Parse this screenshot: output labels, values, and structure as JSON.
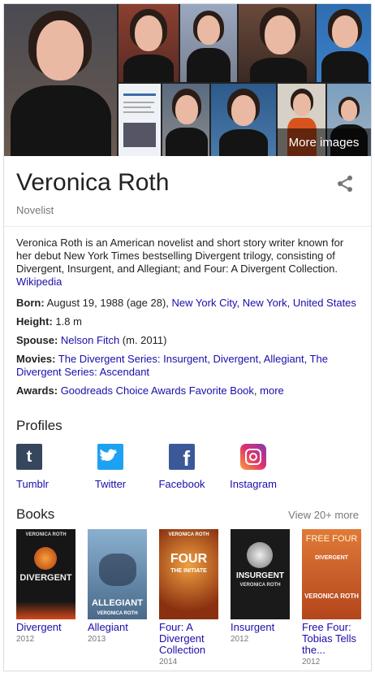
{
  "images": {
    "more_label": "More images"
  },
  "header": {
    "title": "Veronica Roth",
    "subtitle": "Novelist",
    "share_icon": "share-icon"
  },
  "description": {
    "text": "Veronica Roth is an American novelist and short story writer known for her debut New York Times bestselling Divergent trilogy, consisting of Divergent, Insurgent, and Allegiant; and Four: A Divergent Collection.",
    "source": "Wikipedia"
  },
  "facts": {
    "born": {
      "label": "Born:",
      "date": "August 19, 1988 (age 28),",
      "place": "New York City, New York, United States"
    },
    "height": {
      "label": "Height:",
      "value": "1.8 m"
    },
    "spouse": {
      "label": "Spouse:",
      "name": "Nelson Fitch",
      "detail": "(m. 2011)"
    },
    "movies": {
      "label": "Movies:",
      "value": "The Divergent Series: Insurgent, Divergent, Allegiant, The Divergent Series: Ascendant"
    },
    "awards": {
      "label": "Awards:",
      "value": "Goodreads Choice Awards Favorite Book",
      "more": "more"
    }
  },
  "profiles": {
    "heading": "Profiles",
    "items": [
      {
        "label": "Tumblr",
        "color": "#36465d",
        "glyph": "t"
      },
      {
        "label": "Twitter",
        "color": "#1da1f2",
        "glyph": ""
      },
      {
        "label": "Facebook",
        "color": "#3b5998",
        "glyph": "f"
      },
      {
        "label": "Instagram",
        "color": "#c13584",
        "glyph": ""
      }
    ]
  },
  "books": {
    "heading": "Books",
    "view_more": "View 20+ more",
    "items": [
      {
        "title": "Divergent",
        "year": "2012",
        "cover_author": "VERONICA ROTH",
        "cover_title": "DIVERGENT",
        "bg": "#1a1a1a",
        "fg": "#f0f0f0"
      },
      {
        "title": "Allegiant",
        "year": "2013",
        "cover_author": "VERONICA ROTH",
        "cover_title": "ALLEGIANT",
        "bg": "#6f9bbf",
        "fg": "#ffffff"
      },
      {
        "title": "Four: A Divergent Collection",
        "year": "2014",
        "cover_author": "VERONICA ROTH",
        "cover_title": "FOUR",
        "cover_sub": "THE INITIATE",
        "bg": "#c85a1e",
        "fg": "#ffffff"
      },
      {
        "title": "Insurgent",
        "year": "2012",
        "cover_author": "VERONICA ROTH",
        "cover_title": "INSURGENT",
        "bg": "#1c1c1c",
        "fg": "#ffffff"
      },
      {
        "title": "Free Four: Tobias Tells the...",
        "year": "2012",
        "cover_author": "VERONICA ROTH",
        "cover_title": "FREE FOUR",
        "cover_sub": "DIVERGENT",
        "bg": "#d9642a",
        "fg": "#fff4d6"
      }
    ]
  }
}
